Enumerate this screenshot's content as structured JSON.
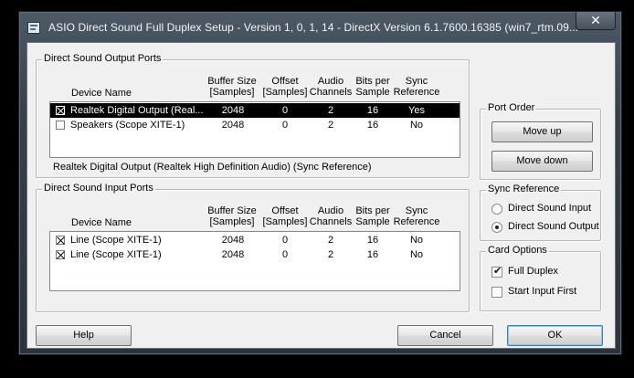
{
  "window": {
    "title": "ASIO Direct Sound Full Duplex Setup   -  Version 1, 0, 1, 14  -  DirectX Version 6.1.7600.16385 (win7_rtm.09...",
    "close_glyph": "✕"
  },
  "output_ports": {
    "title": "Direct Sound Output Ports",
    "headers": {
      "device": "Device Name",
      "buffer": [
        "Buffer Size",
        "[Samples]"
      ],
      "offset": [
        "Offset",
        "[Samples]"
      ],
      "channels": [
        "Audio",
        "Channels"
      ],
      "bits": [
        "Bits per",
        "Sample"
      ],
      "sync": [
        "Sync",
        "Reference"
      ]
    },
    "rows": [
      {
        "name": "Realtek Digital Output (Real...",
        "buffer": "2048",
        "offset": "0",
        "channels": "2",
        "bits": "16",
        "sync": "Yes",
        "checked": true,
        "selected": true
      },
      {
        "name": "Speakers (Scope XITE-1)",
        "buffer": "2048",
        "offset": "0",
        "channels": "2",
        "bits": "16",
        "sync": "No",
        "checked": false,
        "selected": false
      }
    ],
    "status": "Realtek Digital Output (Realtek High Definition Audio) (Sync Reference)"
  },
  "input_ports": {
    "title": "Direct Sound Input Ports",
    "headers": {
      "device": "Device Name",
      "buffer": [
        "Buffer Size",
        "[Samples]"
      ],
      "offset": [
        "Offset",
        "[Samples]"
      ],
      "channels": [
        "Audio",
        "Channels"
      ],
      "bits": [
        "Bits per",
        "Sample"
      ],
      "sync": [
        "Sync",
        "Reference"
      ]
    },
    "rows": [
      {
        "name": "Line (Scope XITE-1)",
        "buffer": "2048",
        "offset": "0",
        "channels": "2",
        "bits": "16",
        "sync": "No",
        "checked": true,
        "selected": false
      },
      {
        "name": "Line (Scope XITE-1)",
        "buffer": "2048",
        "offset": "0",
        "channels": "2",
        "bits": "16",
        "sync": "No",
        "checked": true,
        "selected": false
      }
    ]
  },
  "port_order": {
    "title": "Port Order",
    "move_up": "Move up",
    "move_down": "Move down"
  },
  "sync_reference": {
    "title": "Sync Reference",
    "options": [
      {
        "label": "Direct Sound Input",
        "selected": false
      },
      {
        "label": "Direct Sound Output",
        "selected": true
      }
    ]
  },
  "card_options": {
    "title": "Card Options",
    "options": [
      {
        "label": "Full Duplex",
        "checked": true
      },
      {
        "label": "Start Input First",
        "checked": false
      }
    ]
  },
  "buttons": {
    "help": "Help",
    "cancel": "Cancel",
    "ok": "OK"
  }
}
